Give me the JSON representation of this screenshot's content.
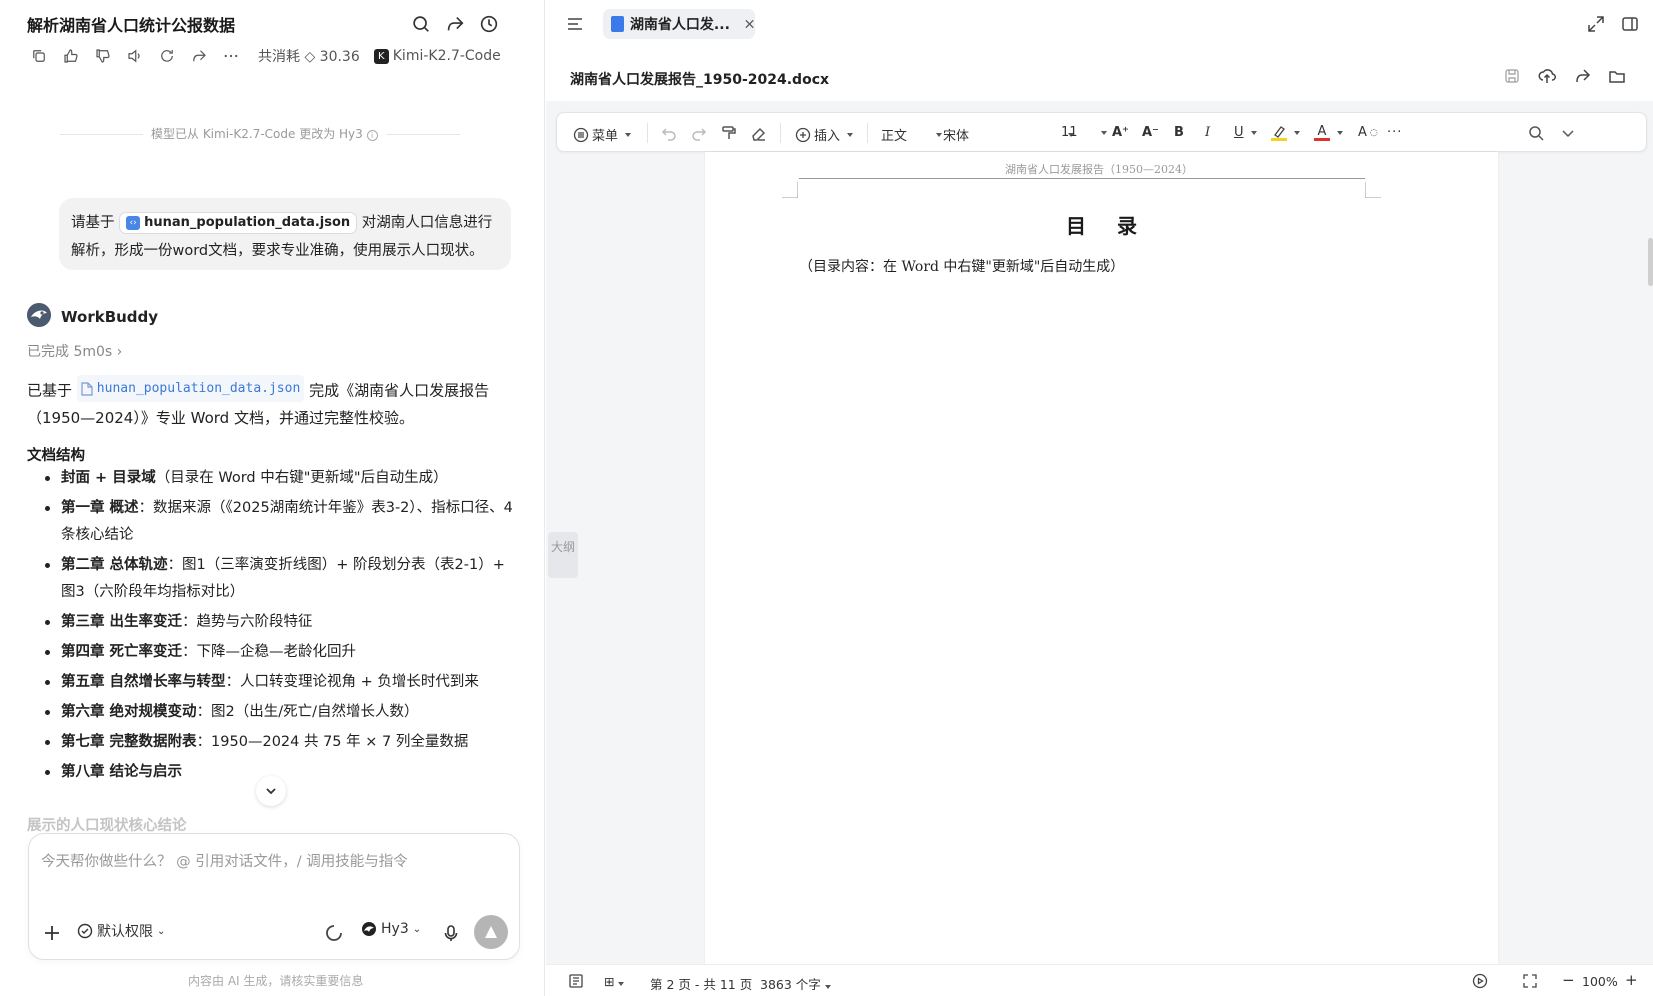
{
  "chat": {
    "title": "解析湖南省人口统计公报数据",
    "usage_text": "共消耗 ◇ 30.36",
    "usage_model": "Kimi-K2.7-Code",
    "model_switch_notice": "模型已从 Kimi-K2.7-Code 更改为 Hy3",
    "user_message": {
      "prefix": "请基于",
      "file_chip": "hunan_population_data.json",
      "suffix": "对湖南人口信息进行解析，形成一份word文档，要求专业准确，使用展示人口现状。"
    },
    "assistant": {
      "name": "WorkBuddy",
      "status": "已完成 5m0s",
      "intro_prefix": "已基于",
      "intro_file": "hunan_population_data.json",
      "intro_suffix": "完成《湖南省人口发展报告（1950—2024）》专业 Word 文档，并通过完整性校验。",
      "section_title": "文档结构",
      "items": [
        {
          "bold": "封面 + 目录域",
          "text": "（目录在 Word 中右键\"更新域\"后自动生成）"
        },
        {
          "bold": "第一章 概述",
          "text": "：数据来源（《2025湖南统计年鉴》表3-2）、指标口径、4 条核心结论"
        },
        {
          "bold": "第二章 总体轨迹",
          "text": "：图1（三率演变折线图）+ 阶段划分表（表2-1）+ 图3（六阶段年均指标对比）"
        },
        {
          "bold": "第三章 出生率变迁",
          "text": "：趋势与六阶段特征"
        },
        {
          "bold": "第四章 死亡率变迁",
          "text": "：下降—企稳—老龄化回升"
        },
        {
          "bold": "第五章 自然增长率与转型",
          "text": "：人口转变理论视角 + 负增长时代到来"
        },
        {
          "bold": "第六章 绝对规模变动",
          "text": "：图2（出生/死亡/自然增长人数）"
        },
        {
          "bold": "第七章 完整数据附表",
          "text": "：1950—2024 共 75 年 × 7 列全量数据"
        },
        {
          "bold": "第八章 结论与启示",
          "text": ""
        }
      ],
      "faded_heading": "展示的人口现状核心结论"
    },
    "composer": {
      "placeholder": "今天帮你做些什么？ @ 引用对话文件，/ 调用技能与指令",
      "permission": "默认权限",
      "model": "Hy3"
    },
    "footnote": "内容由 AI 生成，请核实重要信息"
  },
  "doc": {
    "tab_title": "湖南省人口发...",
    "filename": "湖南省人口发展报告_1950-2024.docx",
    "toolbar": {
      "menu": "菜单",
      "insert": "插入",
      "style": "正文",
      "font": "宋体",
      "size": "11"
    },
    "page": {
      "running_header": "湖南省人口发展报告（1950—2024）",
      "toc_title": "目 录",
      "toc_body": "（目录内容：在 Word 中右键\"更新域\"后自动生成）"
    },
    "outline_label": "大纲",
    "status": {
      "pages": "第 2 页 - 共 11 页",
      "words": "3863 个字",
      "zoom": "100%"
    }
  },
  "colors": {
    "accent_blue": "#3b7ae8",
    "highlight_yellow": "#f3d31c",
    "font_red": "#e03131"
  }
}
